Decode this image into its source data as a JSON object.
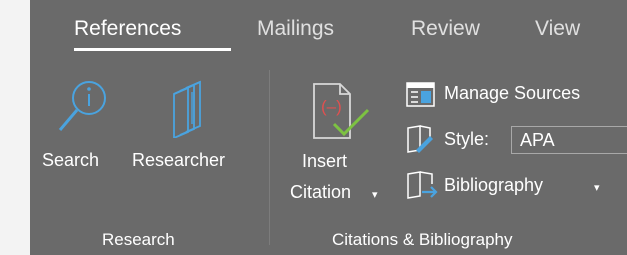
{
  "tabs": [
    {
      "label": "References",
      "active": true
    },
    {
      "label": "Mailings",
      "active": false
    },
    {
      "label": "Review",
      "active": false
    },
    {
      "label": "View",
      "active": false
    }
  ],
  "research": {
    "search_label": "Search",
    "researcher_label": "Researcher",
    "group_label": "Research"
  },
  "citations": {
    "insert_label_line1": "Insert",
    "insert_label_line2": "Citation",
    "manage_sources_label": "Manage Sources",
    "style_label": "Style:",
    "style_value": "APA",
    "bibliography_label": "Bibliography",
    "group_label": "Citations & Bibliography"
  },
  "icons": {
    "search": "search-icon",
    "researcher": "researcher-icon",
    "insert_citation": "insert-citation-icon",
    "manage_sources": "manage-sources-icon",
    "style": "style-icon",
    "bibliography": "bibliography-icon"
  },
  "colors": {
    "ribbon_bg": "#6a6a6a",
    "accent_blue": "#4aa3df",
    "citation_red": "#e05050",
    "citation_green": "#7dc242"
  }
}
